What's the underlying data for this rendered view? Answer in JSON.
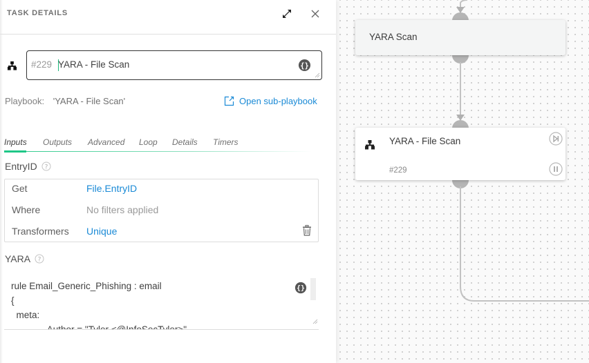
{
  "panel": {
    "title": "TASK DETAILS",
    "expand_icon": "expand-arrows-icon",
    "close_icon": "close-x-icon"
  },
  "task": {
    "type_icon": "sub-playbook-icon",
    "number": "#229",
    "name": "YARA - File Scan",
    "brace_icon": "curly-braces-icon"
  },
  "playbook": {
    "label": "Playbook:",
    "value": "'YARA - File Scan'",
    "open_link": "Open sub-playbook",
    "open_icon": "external-link-icon"
  },
  "tabs": [
    {
      "label": "Inputs",
      "active": true
    },
    {
      "label": "Outputs",
      "active": false
    },
    {
      "label": "Advanced",
      "active": false
    },
    {
      "label": "Loop",
      "active": false
    },
    {
      "label": "Details",
      "active": false
    },
    {
      "label": "Timers",
      "active": false
    }
  ],
  "inputs": {
    "entryid": {
      "label": "EntryID",
      "rows": [
        {
          "key": "Get",
          "value": "File.EntryID",
          "style": "link"
        },
        {
          "key": "Where",
          "value": "No filters applied",
          "style": "muted"
        },
        {
          "key": "Transformers",
          "value": "Unique",
          "style": "link"
        }
      ]
    },
    "yara": {
      "label": "YARA",
      "code": "rule Email_Generic_Phishing : email\n{\n  meta:\n              Author = \"Tyler <@InfoSecTyler>\""
    }
  },
  "canvas": {
    "nodes": [
      {
        "title": "YARA Scan"
      },
      {
        "title": "YARA - File Scan",
        "number": "#229",
        "icon": "sub-playbook-icon",
        "skip_icon": "skip-icon",
        "pause_icon": "pause-icon"
      }
    ]
  }
}
